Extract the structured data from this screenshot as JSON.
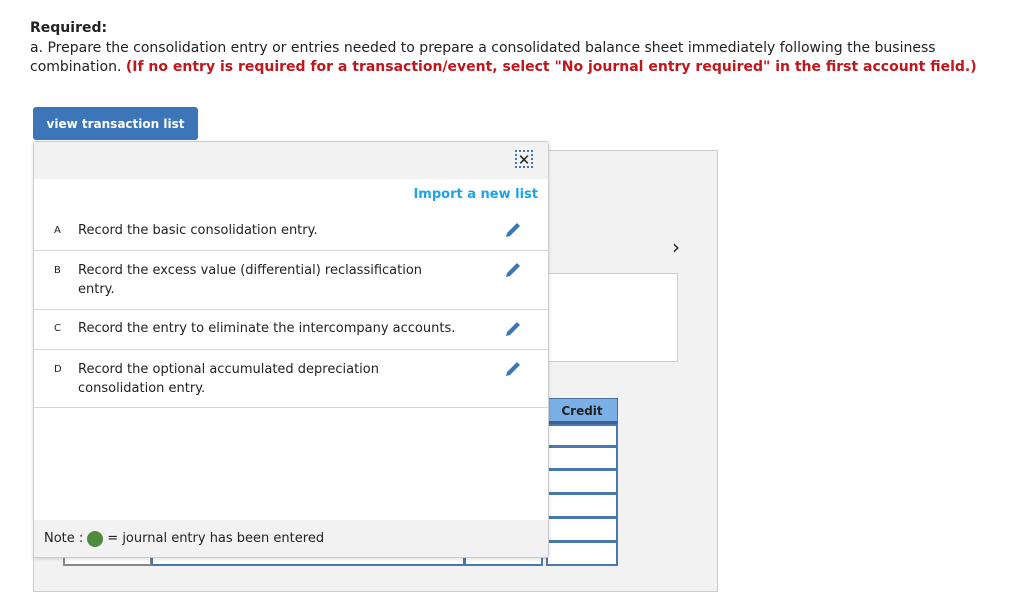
{
  "required_label": "Required:",
  "instruction": "a. Prepare the consolidation entry or entries needed to prepare a consolidated balance sheet immediately following the business combination.",
  "instruction_note": "(If no entry is required for a transaction/event, select \"No journal entry required\" in the first account field.)",
  "view_button": "view transaction list",
  "popup": {
    "close_icon": "close-icon",
    "import_link": "Import a new list",
    "transactions": [
      {
        "letter": "A",
        "text": "Record the basic consolidation entry."
      },
      {
        "letter": "B",
        "text": "Record the excess value (differential) reclassification entry."
      },
      {
        "letter": "C",
        "text": "Record the entry to eliminate the intercompany accounts."
      },
      {
        "letter": "D",
        "text": "Record the optional accumulated depreciation consolidation entry."
      }
    ],
    "note_prefix": "Note :",
    "note_suffix": "= journal entry has been entered"
  },
  "journal": {
    "credit_header": "Credit"
  },
  "colors": {
    "button": "#3d76b8",
    "link": "#1ea3e8",
    "warning": "#c0161c",
    "entered_dot": "#4f8a3e",
    "header": "#7ab0e6"
  }
}
